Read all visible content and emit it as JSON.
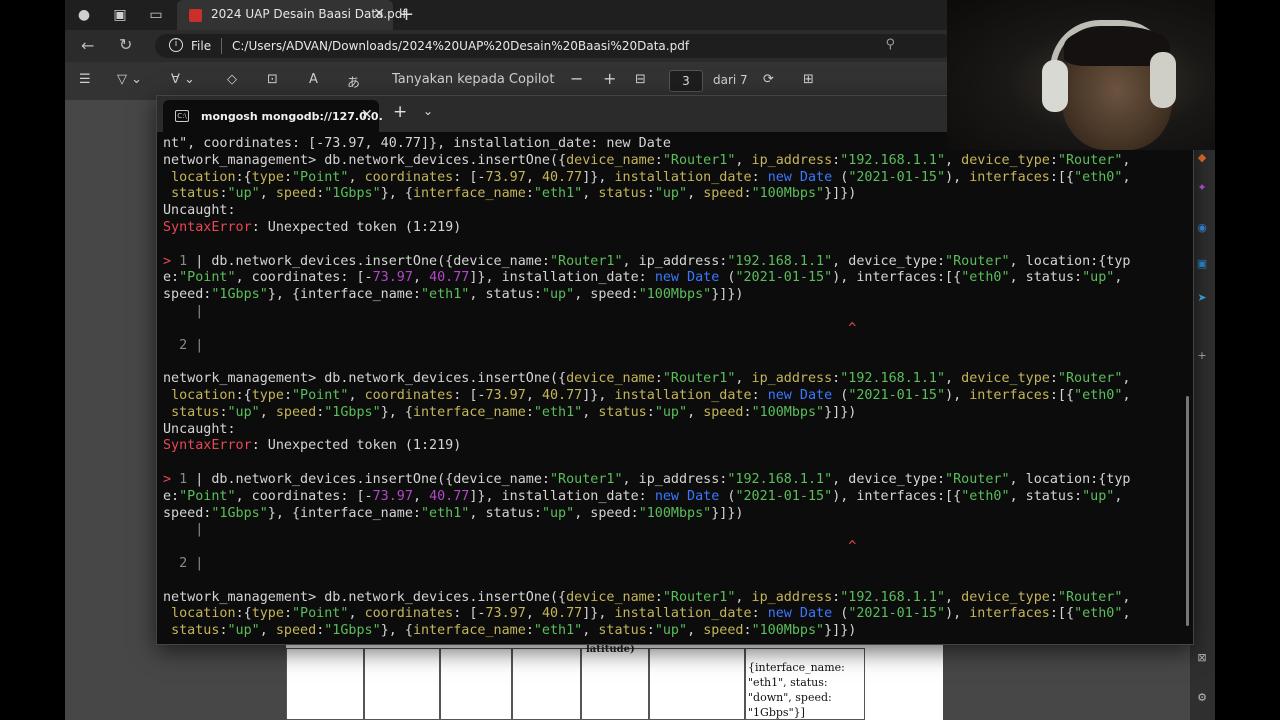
{
  "browser": {
    "tab_title": "2024 UAP Desain Baasi Data.pdf",
    "address_scheme_label": "File",
    "address_url": "C:/Users/ADVAN/Downloads/2024%20UAP%20Desain%20Baasi%20Data.pdf"
  },
  "pdf_toolbar": {
    "copilot_label": "Tanyakan kepada Copilot",
    "zoom_out": "−",
    "zoom_in": "+",
    "current_page": "3",
    "page_total": "dari 7"
  },
  "pdf_page": {
    "latitude_fragment": "latitude)",
    "interface_cell_lines": [
      "{interface_name:",
      "\"eth1\", status:",
      "\"down\", speed:",
      "\"1Gbps\"}]"
    ]
  },
  "terminal": {
    "tab_label": "mongosh mongodb://127.0.0.",
    "lines": [
      [
        [
          "nt\", coordinates: [-73.97, 40.77]}, installation_date: new Date",
          ""
        ]
      ],
      [
        [
          "network_management> db.network_devices.insertOne({",
          ""
        ],
        [
          "device_name",
          "y"
        ],
        [
          ":",
          ""
        ],
        [
          "\"Router1\"",
          "g"
        ],
        [
          ", ",
          ""
        ],
        [
          "ip_address",
          "y"
        ],
        [
          ":",
          ""
        ],
        [
          "\"192.168.1.1\"",
          "g"
        ],
        [
          ", ",
          ""
        ],
        [
          "device_type",
          "y"
        ],
        [
          ":",
          ""
        ],
        [
          "\"Router\"",
          "g"
        ],
        [
          ",",
          ""
        ]
      ],
      [
        [
          " ",
          ""
        ],
        [
          "location",
          "y"
        ],
        [
          ":{",
          ""
        ],
        [
          "type",
          "y"
        ],
        [
          ":",
          ""
        ],
        [
          "\"Point\"",
          "g"
        ],
        [
          ", ",
          ""
        ],
        [
          "coordinates",
          "y"
        ],
        [
          ": [-",
          ""
        ],
        [
          "73.97",
          "y"
        ],
        [
          ", ",
          ""
        ],
        [
          "40.77",
          "y"
        ],
        [
          "]}, ",
          ""
        ],
        [
          "installation_date",
          "y"
        ],
        [
          ": ",
          ""
        ],
        [
          "new Date",
          "b"
        ],
        [
          " (",
          ""
        ],
        [
          "\"2021-01-15\"",
          "g"
        ],
        [
          "), ",
          ""
        ],
        [
          "interfaces",
          "y"
        ],
        [
          ":[{",
          ""
        ],
        [
          "\"eth0\"",
          "g"
        ],
        [
          ",",
          ""
        ]
      ],
      [
        [
          " ",
          ""
        ],
        [
          "status",
          "y"
        ],
        [
          ":",
          ""
        ],
        [
          "\"up\"",
          "g"
        ],
        [
          ", ",
          ""
        ],
        [
          "speed",
          "y"
        ],
        [
          ":",
          ""
        ],
        [
          "\"1Gbps\"",
          "g"
        ],
        [
          "}, {",
          ""
        ],
        [
          "interface_name",
          "y"
        ],
        [
          ":",
          ""
        ],
        [
          "\"eth1\"",
          "g"
        ],
        [
          ", ",
          ""
        ],
        [
          "status",
          "y"
        ],
        [
          ":",
          ""
        ],
        [
          "\"up\"",
          "g"
        ],
        [
          ", ",
          ""
        ],
        [
          "speed",
          "y"
        ],
        [
          ":",
          ""
        ],
        [
          "\"100Mbps\"",
          "g"
        ],
        [
          "}]})",
          ""
        ]
      ],
      [
        [
          "Uncaught:",
          ""
        ]
      ],
      [
        [
          "SyntaxError",
          "r"
        ],
        [
          ": Unexpected token (1:219)",
          ""
        ]
      ],
      [
        [
          "",
          ""
        ]
      ],
      [
        [
          "> ",
          "r"
        ],
        [
          "1 ",
          "dim"
        ],
        [
          "| db.network_devices.insertOne({device_name:",
          ""
        ],
        [
          "\"Router1\"",
          "g"
        ],
        [
          ", ip_address:",
          ""
        ],
        [
          "\"192.168.1.1\"",
          "g"
        ],
        [
          ", device_type:",
          ""
        ],
        [
          "\"Router\"",
          "g"
        ],
        [
          ", location:{typ",
          ""
        ]
      ],
      [
        [
          "e:",
          ""
        ],
        [
          "\"Point\"",
          "g"
        ],
        [
          ", coordinates: [-",
          ""
        ],
        [
          "73.97",
          "m"
        ],
        [
          ", ",
          ""
        ],
        [
          "40.77",
          "m"
        ],
        [
          "]}, installation_date: ",
          ""
        ],
        [
          "new Date",
          "b"
        ],
        [
          " (",
          ""
        ],
        [
          "\"2021-01-15\"",
          "g"
        ],
        [
          "), interfaces:[{",
          ""
        ],
        [
          "\"eth0\"",
          "g"
        ],
        [
          ", status:",
          ""
        ],
        [
          "\"up\"",
          "g"
        ],
        [
          ",",
          ""
        ]
      ],
      [
        [
          "speed:",
          ""
        ],
        [
          "\"1Gbps\"",
          "g"
        ],
        [
          "}, {interface_name:",
          ""
        ],
        [
          "\"eth1\"",
          "g"
        ],
        [
          ", status:",
          ""
        ],
        [
          "\"up\"",
          "g"
        ],
        [
          ", speed:",
          ""
        ],
        [
          "\"100Mbps\"",
          "g"
        ],
        [
          "}]})",
          ""
        ]
      ],
      [
        [
          "    ",
          ""
        ],
        [
          "|",
          "dim"
        ]
      ],
      [
        [
          "                                                                                     ",
          ""
        ],
        [
          "^",
          "r"
        ]
      ],
      [
        [
          "  ",
          ""
        ],
        [
          "2 ",
          "dim"
        ],
        [
          "|",
          "dim"
        ]
      ],
      [
        [
          "",
          ""
        ]
      ],
      [
        [
          "network_management> db.network_devices.insertOne({",
          ""
        ],
        [
          "device_name",
          "y"
        ],
        [
          ":",
          ""
        ],
        [
          "\"Router1\"",
          "g"
        ],
        [
          ", ",
          ""
        ],
        [
          "ip_address",
          "y"
        ],
        [
          ":",
          ""
        ],
        [
          "\"192.168.1.1\"",
          "g"
        ],
        [
          ", ",
          ""
        ],
        [
          "device_type",
          "y"
        ],
        [
          ":",
          ""
        ],
        [
          "\"Router\"",
          "g"
        ],
        [
          ",",
          ""
        ]
      ],
      [
        [
          " ",
          ""
        ],
        [
          "location",
          "y"
        ],
        [
          ":{",
          ""
        ],
        [
          "type",
          "y"
        ],
        [
          ":",
          ""
        ],
        [
          "\"Point\"",
          "g"
        ],
        [
          ", ",
          ""
        ],
        [
          "coordinates",
          "y"
        ],
        [
          ": [-",
          ""
        ],
        [
          "73.97",
          "y"
        ],
        [
          ", ",
          ""
        ],
        [
          "40.77",
          "y"
        ],
        [
          "]}, ",
          ""
        ],
        [
          "installation_date",
          "y"
        ],
        [
          ": ",
          ""
        ],
        [
          "new Date",
          "b"
        ],
        [
          " (",
          ""
        ],
        [
          "\"2021-01-15\"",
          "g"
        ],
        [
          "), ",
          ""
        ],
        [
          "interfaces",
          "y"
        ],
        [
          ":[{",
          ""
        ],
        [
          "\"eth0\"",
          "g"
        ],
        [
          ",",
          ""
        ]
      ],
      [
        [
          " ",
          ""
        ],
        [
          "status",
          "y"
        ],
        [
          ":",
          ""
        ],
        [
          "\"up\"",
          "g"
        ],
        [
          ", ",
          ""
        ],
        [
          "speed",
          "y"
        ],
        [
          ":",
          ""
        ],
        [
          "\"1Gbps\"",
          "g"
        ],
        [
          "}, {",
          ""
        ],
        [
          "interface_name",
          "y"
        ],
        [
          ":",
          ""
        ],
        [
          "\"eth1\"",
          "g"
        ],
        [
          ", ",
          ""
        ],
        [
          "status",
          "y"
        ],
        [
          ":",
          ""
        ],
        [
          "\"up\"",
          "g"
        ],
        [
          ", ",
          ""
        ],
        [
          "speed",
          "y"
        ],
        [
          ":",
          ""
        ],
        [
          "\"100Mbps\"",
          "g"
        ],
        [
          "}]})",
          ""
        ]
      ],
      [
        [
          "Uncaught:",
          ""
        ]
      ],
      [
        [
          "SyntaxError",
          "r"
        ],
        [
          ": Unexpected token (1:219)",
          ""
        ]
      ],
      [
        [
          "",
          ""
        ]
      ],
      [
        [
          "> ",
          "r"
        ],
        [
          "1 ",
          "dim"
        ],
        [
          "| db.network_devices.insertOne({device_name:",
          ""
        ],
        [
          "\"Router1\"",
          "g"
        ],
        [
          ", ip_address:",
          ""
        ],
        [
          "\"192.168.1.1\"",
          "g"
        ],
        [
          ", device_type:",
          ""
        ],
        [
          "\"Router\"",
          "g"
        ],
        [
          ", location:{typ",
          ""
        ]
      ],
      [
        [
          "e:",
          ""
        ],
        [
          "\"Point\"",
          "g"
        ],
        [
          ", coordinates: [-",
          ""
        ],
        [
          "73.97",
          "m"
        ],
        [
          ", ",
          ""
        ],
        [
          "40.77",
          "m"
        ],
        [
          "]}, installation_date: ",
          ""
        ],
        [
          "new Date",
          "b"
        ],
        [
          " (",
          ""
        ],
        [
          "\"2021-01-15\"",
          "g"
        ],
        [
          "), interfaces:[{",
          ""
        ],
        [
          "\"eth0\"",
          "g"
        ],
        [
          ", status:",
          ""
        ],
        [
          "\"up\"",
          "g"
        ],
        [
          ",",
          ""
        ]
      ],
      [
        [
          "speed:",
          ""
        ],
        [
          "\"1Gbps\"",
          "g"
        ],
        [
          "}, {interface_name:",
          ""
        ],
        [
          "\"eth1\"",
          "g"
        ],
        [
          ", status:",
          ""
        ],
        [
          "\"up\"",
          "g"
        ],
        [
          ", speed:",
          ""
        ],
        [
          "\"100Mbps\"",
          "g"
        ],
        [
          "}]})",
          ""
        ]
      ],
      [
        [
          "    ",
          ""
        ],
        [
          "|",
          "dim"
        ]
      ],
      [
        [
          "                                                                                     ",
          ""
        ],
        [
          "^",
          "r"
        ]
      ],
      [
        [
          "  ",
          ""
        ],
        [
          "2 ",
          "dim"
        ],
        [
          "|",
          "dim"
        ]
      ],
      [
        [
          "",
          ""
        ]
      ],
      [
        [
          "network_management> db.network_devices.insertOne({",
          ""
        ],
        [
          "device_name",
          "y"
        ],
        [
          ":",
          ""
        ],
        [
          "\"Router1\"",
          "g"
        ],
        [
          ", ",
          ""
        ],
        [
          "ip_address",
          "y"
        ],
        [
          ":",
          ""
        ],
        [
          "\"192.168.1.1\"",
          "g"
        ],
        [
          ", ",
          ""
        ],
        [
          "device_type",
          "y"
        ],
        [
          ":",
          ""
        ],
        [
          "\"Router\"",
          "g"
        ],
        [
          ",",
          ""
        ]
      ],
      [
        [
          " ",
          ""
        ],
        [
          "location",
          "y"
        ],
        [
          ":{",
          ""
        ],
        [
          "type",
          "y"
        ],
        [
          ":",
          ""
        ],
        [
          "\"Point\"",
          "g"
        ],
        [
          ", ",
          ""
        ],
        [
          "coordinates",
          "y"
        ],
        [
          ": [-",
          ""
        ],
        [
          "73.97",
          "y"
        ],
        [
          ", ",
          ""
        ],
        [
          "40.77",
          "y"
        ],
        [
          "]}, ",
          ""
        ],
        [
          "installation_date",
          "y"
        ],
        [
          ": ",
          ""
        ],
        [
          "new Date",
          "b"
        ],
        [
          " (",
          ""
        ],
        [
          "\"2021-01-15\"",
          "g"
        ],
        [
          "), ",
          ""
        ],
        [
          "interfaces",
          "y"
        ],
        [
          ":[{",
          ""
        ],
        [
          "\"eth0\"",
          "g"
        ],
        [
          ",",
          ""
        ]
      ],
      [
        [
          " ",
          ""
        ],
        [
          "status",
          "y"
        ],
        [
          ":",
          ""
        ],
        [
          "\"up\"",
          "g"
        ],
        [
          ", ",
          ""
        ],
        [
          "speed",
          "y"
        ],
        [
          ":",
          ""
        ],
        [
          "\"1Gbps\"",
          "g"
        ],
        [
          "}, {",
          ""
        ],
        [
          "interface_name",
          "y"
        ],
        [
          ":",
          ""
        ],
        [
          "\"eth1\"",
          "g"
        ],
        [
          ", ",
          ""
        ],
        [
          "status",
          "y"
        ],
        [
          ":",
          ""
        ],
        [
          "\"up\"",
          "g"
        ],
        [
          ", ",
          ""
        ],
        [
          "speed",
          "y"
        ],
        [
          ":",
          ""
        ],
        [
          "\"100Mbps\"",
          "g"
        ],
        [
          "}]})",
          ""
        ]
      ]
    ]
  },
  "colors": {
    "string_green": "#5bbd5b",
    "key_yellow": "#c4b45a",
    "error_red": "#e74856",
    "keyword_blue": "#3b78ff",
    "number_magenta": "#b148c6"
  }
}
